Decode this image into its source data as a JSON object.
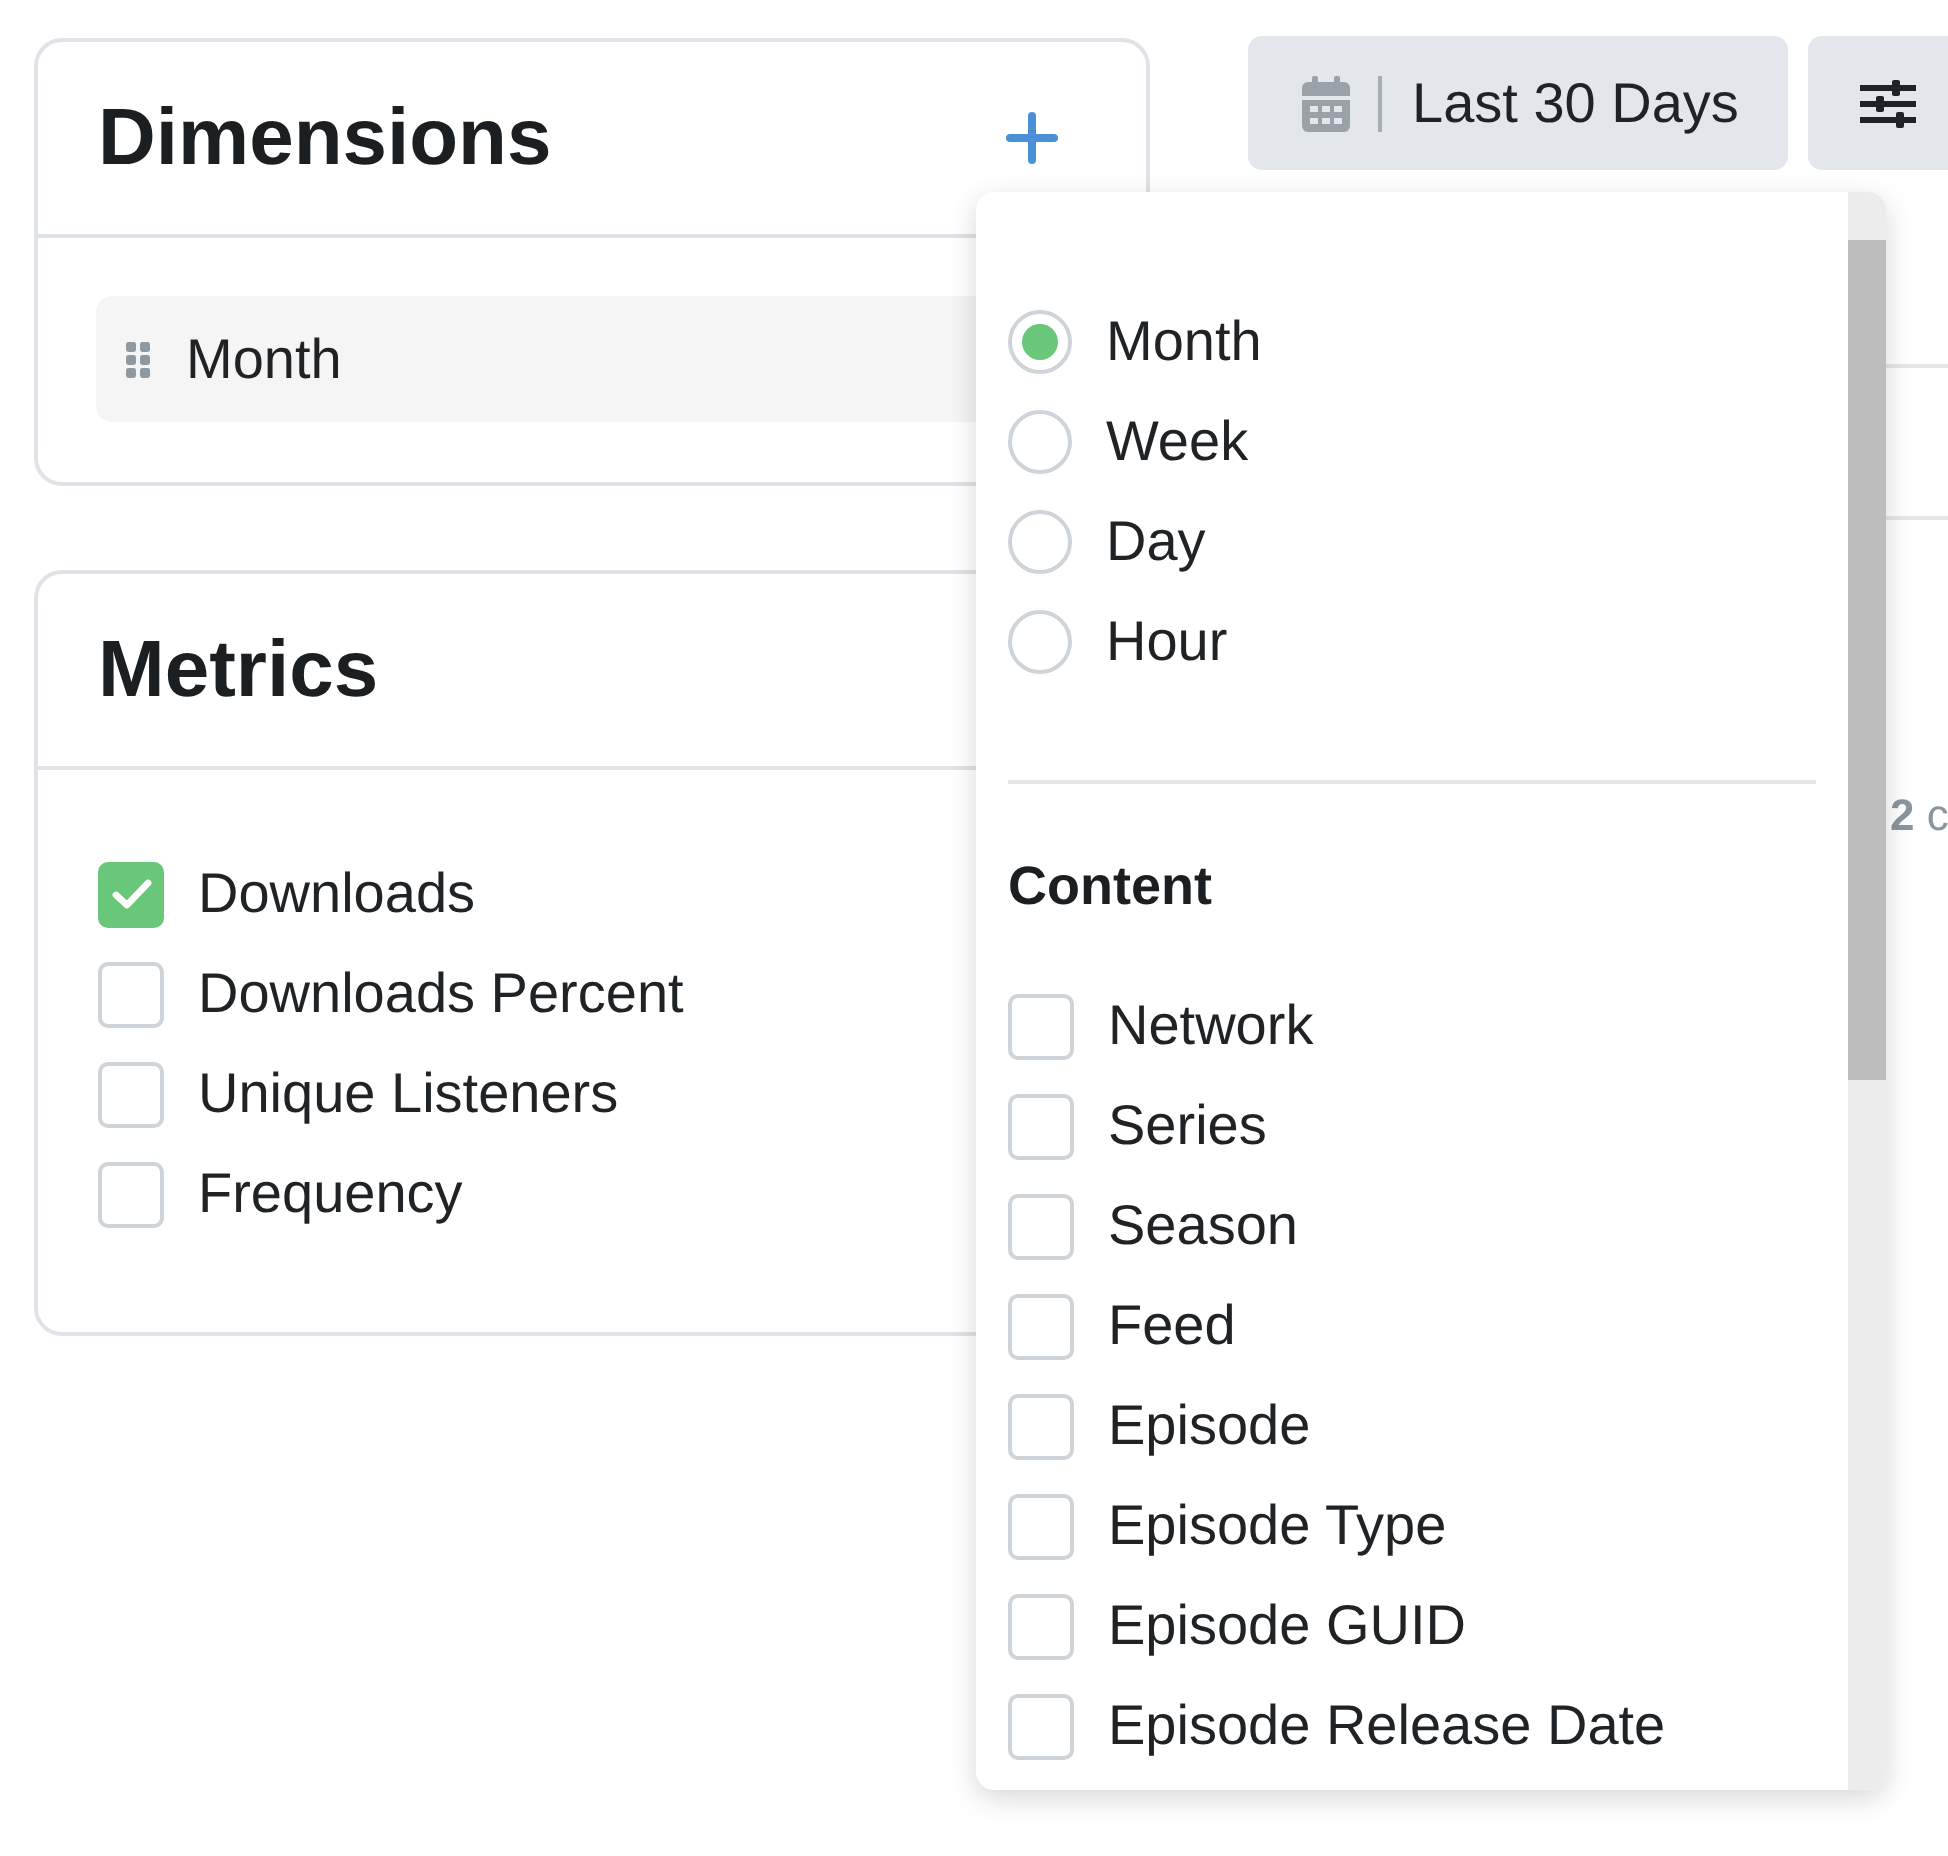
{
  "dimensions": {
    "title": "Dimensions",
    "items": [
      {
        "label": "Month"
      }
    ]
  },
  "metrics": {
    "title": "Metrics",
    "items": [
      {
        "label": "Downloads",
        "checked": true
      },
      {
        "label": "Downloads Percent",
        "checked": false
      },
      {
        "label": "Unique Listeners",
        "checked": false
      },
      {
        "label": "Frequency",
        "checked": false
      }
    ]
  },
  "toolbar": {
    "date_range": "Last 30 Days"
  },
  "background_panel": {
    "text": "**2** c"
  },
  "dropdown": {
    "intervals": [
      {
        "label": "Month",
        "selected": true
      },
      {
        "label": "Week",
        "selected": false
      },
      {
        "label": "Day",
        "selected": false
      },
      {
        "label": "Hour",
        "selected": false
      }
    ],
    "section": {
      "title": "Content",
      "options": [
        {
          "label": "Network",
          "checked": false
        },
        {
          "label": "Series",
          "checked": false
        },
        {
          "label": "Season",
          "checked": false
        },
        {
          "label": "Feed",
          "checked": false
        },
        {
          "label": "Episode",
          "checked": false
        },
        {
          "label": "Episode Type",
          "checked": false
        },
        {
          "label": "Episode GUID",
          "checked": false
        },
        {
          "label": "Episode Release Date",
          "checked": false
        }
      ]
    }
  }
}
